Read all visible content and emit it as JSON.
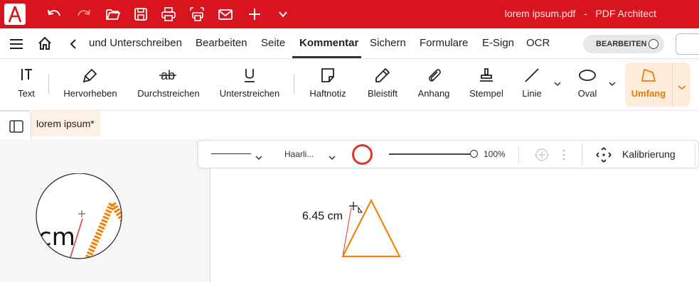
{
  "app": {
    "file_name": "lorem ipsum.pdf",
    "separator": "-",
    "app_name": "PDF Architect",
    "accent_color": "#d8141f",
    "quick_access_icons": [
      "app-logo-icon",
      "undo-icon",
      "redo-icon",
      "open-folder-icon",
      "save-icon",
      "print-icon",
      "scan-print-icon",
      "email-icon",
      "add-icon",
      "chevron-down-icon"
    ]
  },
  "menu": {
    "items": [
      "und Unterschreiben",
      "Bearbeiten",
      "Seite",
      "Kommentar",
      "Sichern",
      "Formulare",
      "E-Sign",
      "OCR"
    ],
    "active": "Kommentar",
    "edit_toggle": "BEARBEITEN"
  },
  "toolbar": {
    "tools": [
      {
        "label": "Text",
        "icon": "text-cursor-icon"
      },
      {
        "label": "Hervorheben",
        "icon": "highlighter-icon"
      },
      {
        "label": "Durchstreichen",
        "icon": "strikethrough-icon"
      },
      {
        "label": "Unterstreichen",
        "icon": "underline-icon"
      },
      {
        "label": "Haftnotiz",
        "icon": "sticky-note-icon"
      },
      {
        "label": "Bleistift",
        "icon": "pencil-icon"
      },
      {
        "label": "Anhang",
        "icon": "paperclip-icon"
      },
      {
        "label": "Stempel",
        "icon": "stamp-icon"
      },
      {
        "label": "Linie",
        "icon": "line-icon"
      },
      {
        "label": "Oval",
        "icon": "oval-icon"
      },
      {
        "label": "Umfang",
        "icon": "perimeter-icon"
      }
    ],
    "active": "Umfang",
    "active_color": "#e87b00"
  },
  "document": {
    "tab_title": "lorem ipsum",
    "modified_marker": "*"
  },
  "format_bar": {
    "line_style": "solid",
    "line_width": "Haarli...",
    "stroke_color": "#e8302a",
    "opacity": "100%",
    "opacity_fraction": 1.0,
    "calibrate_label": "Kalibrierung"
  },
  "canvas": {
    "measurement_label": "6.45 cm",
    "shape_color": "#f0830a",
    "magnifier_text": "cm"
  }
}
